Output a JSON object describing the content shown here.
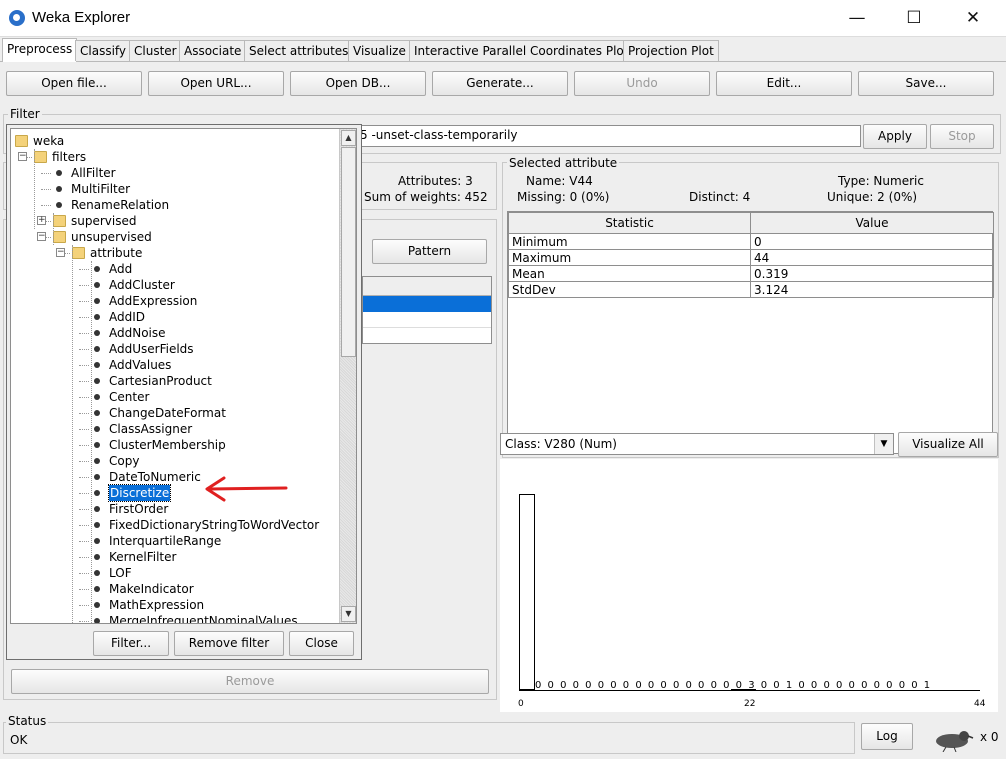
{
  "window": {
    "title": "Weka Explorer",
    "minimize": "—",
    "maximize": "☐",
    "close": "✕"
  },
  "tabs": [
    "Preprocess",
    "Classify",
    "Cluster",
    "Associate",
    "Select attributes",
    "Visualize",
    "Interactive Parallel Coordinates Plot",
    "Projection Plot"
  ],
  "toolbar": {
    "open_file": "Open file...",
    "open_url": "Open URL...",
    "open_db": "Open DB...",
    "generate": "Generate...",
    "undo": "Undo",
    "edit": "Edit...",
    "save": "Save..."
  },
  "filter": {
    "label": "Filter",
    "command_text": "5 -unset-class-temporarily",
    "apply": "Apply",
    "stop": "Stop"
  },
  "relation": {
    "attributes": "Attributes: 3",
    "sum_of_weights": "Sum of weights: 452"
  },
  "attributes_panel": {
    "pattern_button": "Pattern",
    "remove_button": "Remove"
  },
  "selected_attribute": {
    "label": "Selected attribute",
    "name": "Name: V44",
    "type": "Type: Numeric",
    "missing": "Missing: 0 (0%)",
    "distinct": "Distinct: 4",
    "unique": "Unique: 2 (0%)",
    "table_headers": [
      "Statistic",
      "Value"
    ],
    "rows": [
      {
        "statistic": "Minimum",
        "value": "0"
      },
      {
        "statistic": "Maximum",
        "value": "44"
      },
      {
        "statistic": "Mean",
        "value": "0.319"
      },
      {
        "statistic": "StdDev",
        "value": "3.124"
      }
    ]
  },
  "class_select": {
    "value": "Class: V280 (Num)",
    "visualize_all": "Visualize All"
  },
  "histogram": {
    "counts_label": "0 0 0 0 0 0 0 0 0 0 0 0 0 0 0 0 0 3 0 0 1 0 0 0 0 0 0 0 0 0 0 1",
    "x_ticks": [
      "0",
      "22",
      "44"
    ]
  },
  "status": {
    "label": "Status",
    "text": "OK",
    "log_button": "Log",
    "count": "x 0"
  },
  "tree": {
    "nodes": [
      {
        "label": "weka",
        "depth": 0,
        "kind": "folder"
      },
      {
        "label": "filters",
        "depth": 1,
        "kind": "folder",
        "expander": "−"
      },
      {
        "label": "AllFilter",
        "depth": 2,
        "kind": "leaf"
      },
      {
        "label": "MultiFilter",
        "depth": 2,
        "kind": "leaf"
      },
      {
        "label": "RenameRelation",
        "depth": 2,
        "kind": "leaf"
      },
      {
        "label": "supervised",
        "depth": 2,
        "kind": "folder",
        "expander": "+"
      },
      {
        "label": "unsupervised",
        "depth": 2,
        "kind": "folder",
        "expander": "−"
      },
      {
        "label": "attribute",
        "depth": 3,
        "kind": "folder",
        "expander": "−"
      },
      {
        "label": "Add",
        "depth": 4,
        "kind": "leaf"
      },
      {
        "label": "AddCluster",
        "depth": 4,
        "kind": "leaf"
      },
      {
        "label": "AddExpression",
        "depth": 4,
        "kind": "leaf"
      },
      {
        "label": "AddID",
        "depth": 4,
        "kind": "leaf"
      },
      {
        "label": "AddNoise",
        "depth": 4,
        "kind": "leaf"
      },
      {
        "label": "AddUserFields",
        "depth": 4,
        "kind": "leaf"
      },
      {
        "label": "AddValues",
        "depth": 4,
        "kind": "leaf"
      },
      {
        "label": "CartesianProduct",
        "depth": 4,
        "kind": "leaf"
      },
      {
        "label": "Center",
        "depth": 4,
        "kind": "leaf"
      },
      {
        "label": "ChangeDateFormat",
        "depth": 4,
        "kind": "leaf"
      },
      {
        "label": "ClassAssigner",
        "depth": 4,
        "kind": "leaf"
      },
      {
        "label": "ClusterMembership",
        "depth": 4,
        "kind": "leaf"
      },
      {
        "label": "Copy",
        "depth": 4,
        "kind": "leaf"
      },
      {
        "label": "DateToNumeric",
        "depth": 4,
        "kind": "leaf"
      },
      {
        "label": "Discretize",
        "depth": 4,
        "kind": "leaf",
        "selected": true
      },
      {
        "label": "FirstOrder",
        "depth": 4,
        "kind": "leaf"
      },
      {
        "label": "FixedDictionaryStringToWordVector",
        "depth": 4,
        "kind": "leaf"
      },
      {
        "label": "InterquartileRange",
        "depth": 4,
        "kind": "leaf"
      },
      {
        "label": "KernelFilter",
        "depth": 4,
        "kind": "leaf"
      },
      {
        "label": "LOF",
        "depth": 4,
        "kind": "leaf"
      },
      {
        "label": "MakeIndicator",
        "depth": 4,
        "kind": "leaf"
      },
      {
        "label": "MathExpression",
        "depth": 4,
        "kind": "leaf"
      },
      {
        "label": "MergeInfrequentNominalValues",
        "depth": 4,
        "kind": "leaf"
      }
    ],
    "filter_button": "Filter...",
    "remove_filter_button": "Remove filter",
    "close_button": "Close"
  },
  "colors": {
    "selection": "#0a6fd8",
    "annotation_arrow": "#e02020"
  }
}
